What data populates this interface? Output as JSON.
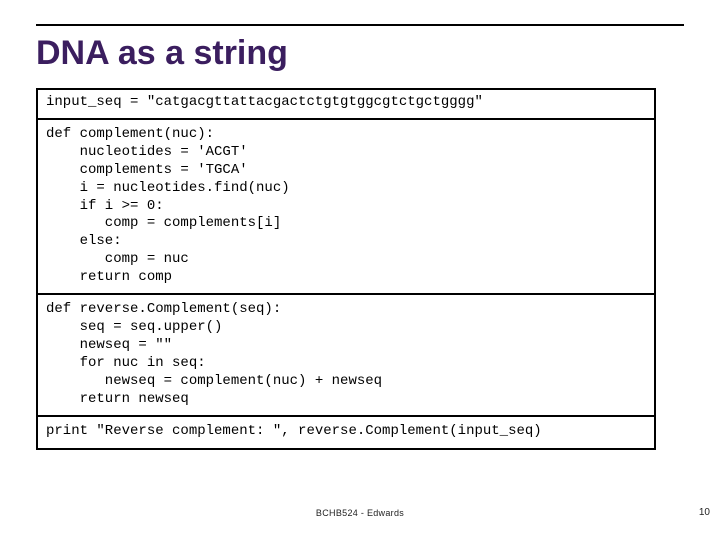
{
  "title": "DNA as a string",
  "code": {
    "line_input": "input_seq = \"catgacgttattacgactctgtgtggcgtctgctgggg\"",
    "block1": "def complement(nuc):\n    nucleotides = 'ACGT'\n    complements = 'TGCA'\n    i = nucleotides.find(nuc)\n    if i >= 0:\n       comp = complements[i]\n    else:\n       comp = nuc\n    return comp",
    "block2": "def reverse.Complement(seq):\n    seq = seq.upper()\n    newseq = \"\"\n    for nuc in seq:\n       newseq = complement(nuc) + newseq\n    return newseq",
    "line_print": "print \"Reverse complement: \", reverse.Complement(input_seq)"
  },
  "footer": "BCHB524 - Edwards",
  "page_number": "10"
}
